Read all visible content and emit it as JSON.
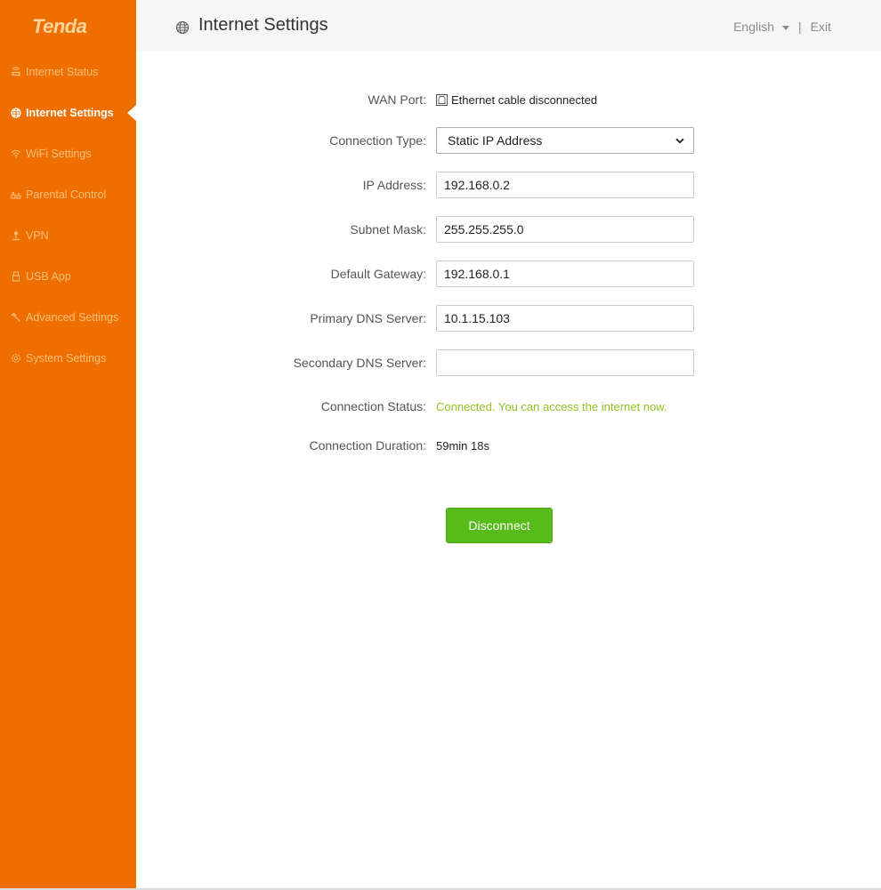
{
  "brand": {
    "logo": "Tenda",
    "accent": "#ee6e00",
    "sidebar_text": "#fcc07a",
    "success": "#8dc21f",
    "button": "#57bb1a"
  },
  "sidebar": {
    "items": [
      {
        "label": "Internet Status",
        "icon": "router-icon",
        "active": false
      },
      {
        "label": "Internet Settings",
        "icon": "globe-icon",
        "active": true
      },
      {
        "label": "WiFi Settings",
        "icon": "wifi-icon",
        "active": false
      },
      {
        "label": "Parental Control",
        "icon": "parental-icon",
        "active": false
      },
      {
        "label": "VPN",
        "icon": "vpn-icon",
        "active": false
      },
      {
        "label": "USB App",
        "icon": "usb-icon",
        "active": false
      },
      {
        "label": "Advanced Settings",
        "icon": "wrench-icon",
        "active": false
      },
      {
        "label": "System Settings",
        "icon": "gear-icon",
        "active": false
      }
    ]
  },
  "header": {
    "title": "Internet Settings",
    "language": "English",
    "separator": "|",
    "exit": "Exit"
  },
  "form": {
    "wan_port": {
      "label": "WAN Port:",
      "value": "Ethernet cable disconnected"
    },
    "connection_type": {
      "label": "Connection Type:",
      "value": "Static IP Address"
    },
    "ip_address": {
      "label": "IP Address:",
      "value": "192.168.0.2"
    },
    "subnet_mask": {
      "label": "Subnet Mask:",
      "value": "255.255.255.0"
    },
    "default_gateway": {
      "label": "Default Gateway:",
      "value": "192.168.0.1"
    },
    "primary_dns": {
      "label": "Primary DNS Server:",
      "value": "10.1.15.103"
    },
    "secondary_dns": {
      "label": "Secondary DNS Server:",
      "value": ""
    },
    "connection_status": {
      "label": "Connection Status:",
      "value": "Connected. You can access the internet now."
    },
    "connection_duration": {
      "label": "Connection Duration:",
      "value": "59min 18s"
    },
    "disconnect_label": "Disconnect"
  }
}
